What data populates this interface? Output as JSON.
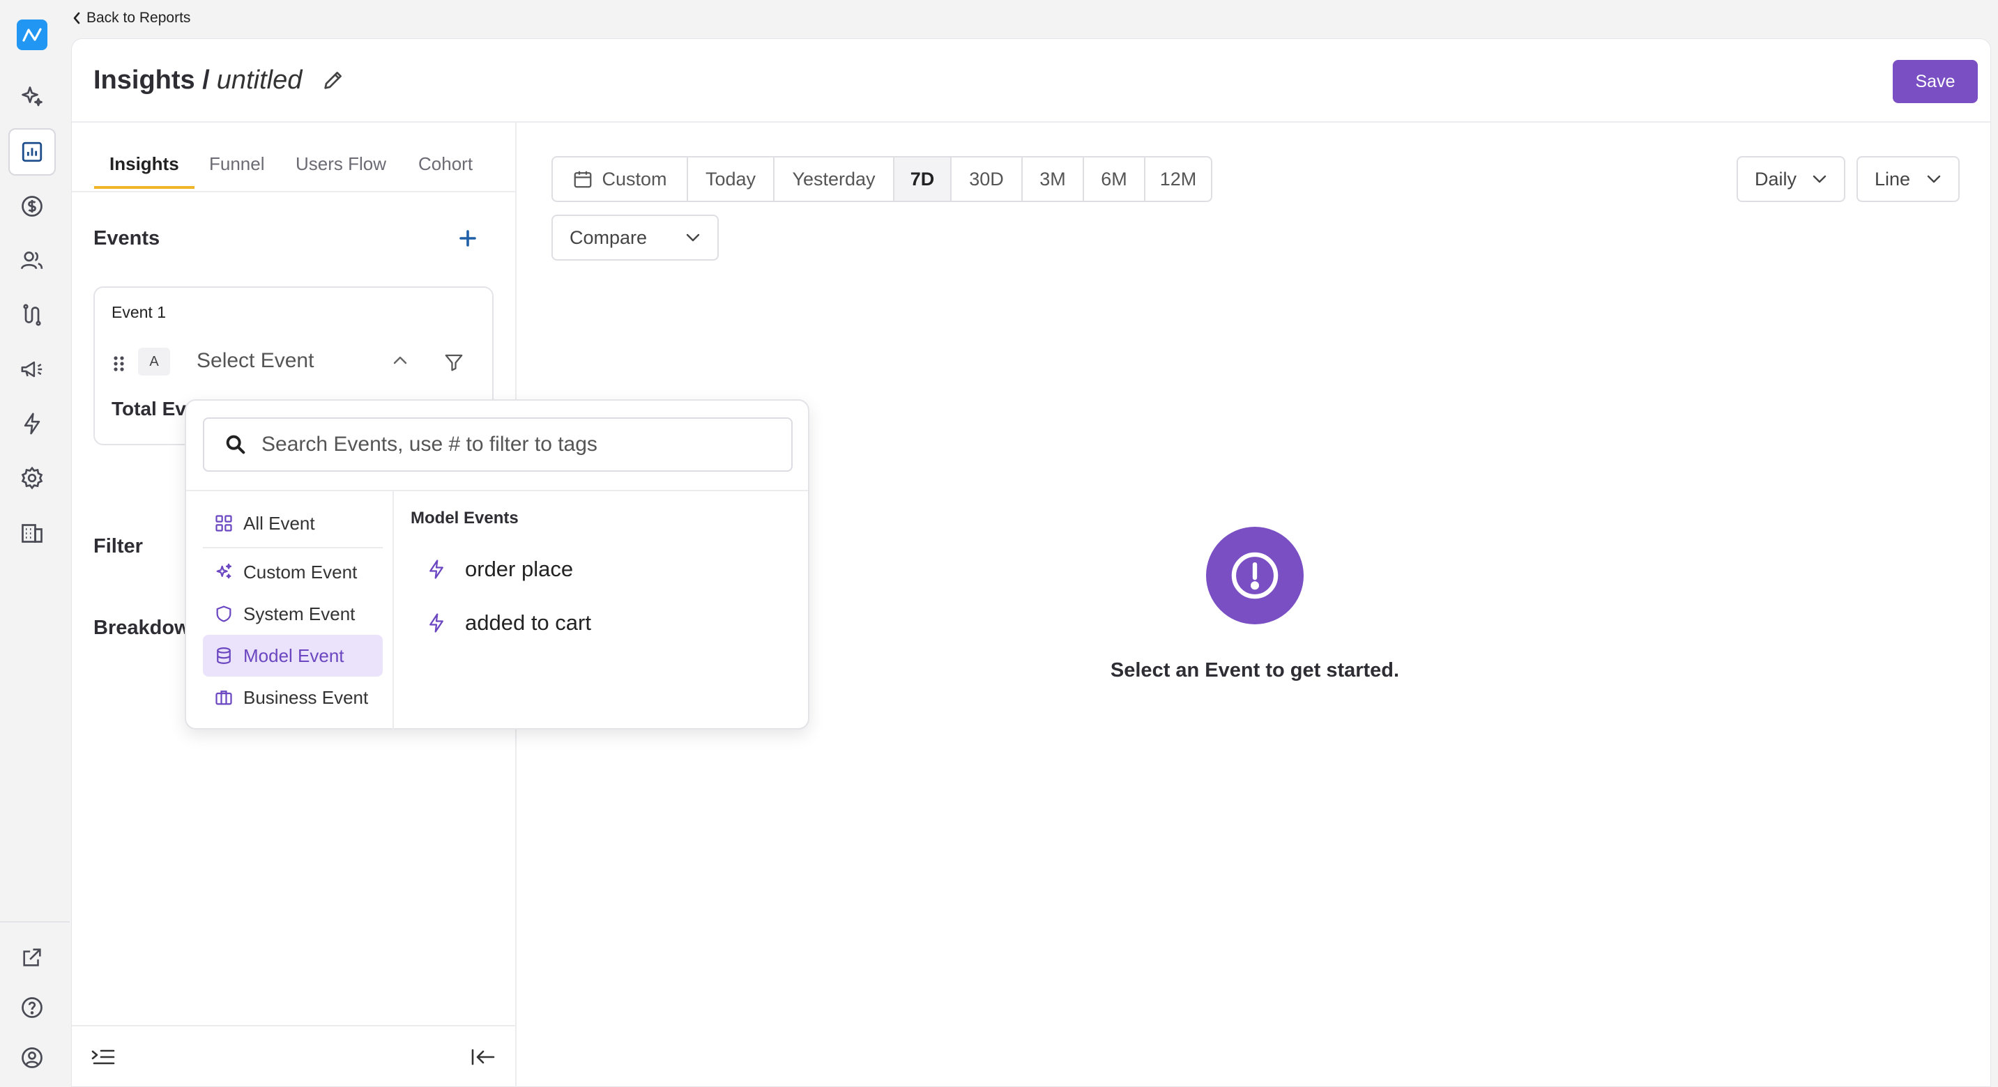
{
  "back_link": {
    "label": "Back to Reports"
  },
  "header": {
    "title_main": "Insights /",
    "title_sub": "untitled",
    "save_label": "Save"
  },
  "sidebar": {
    "icons": [
      "app-logo-icon",
      "sparkles-icon",
      "reports-icon",
      "dollar-icon",
      "users-icon",
      "journey-icon",
      "megaphone-icon",
      "bolt-icon",
      "settings-icon",
      "building-icon",
      "external-link-icon",
      "help-icon",
      "user-account-icon"
    ],
    "active": "reports-icon"
  },
  "tabs": [
    {
      "label": "Insights",
      "active": true
    },
    {
      "label": "Funnel",
      "active": false
    },
    {
      "label": "Users Flow",
      "active": false
    },
    {
      "label": "Cohort",
      "active": false
    }
  ],
  "left_panel": {
    "events_title": "Events",
    "event_card": {
      "name": "Event 1",
      "letter": "A",
      "select_label": "Select Event",
      "metric_label": "Total Ev"
    },
    "filter_title": "Filter",
    "breakdown_title": "Breakdow"
  },
  "toolbar": {
    "ranges": [
      {
        "label": "Custom",
        "active": false
      },
      {
        "label": "Today",
        "active": false
      },
      {
        "label": "Yesterday",
        "active": false
      },
      {
        "label": "7D",
        "active": true
      },
      {
        "label": "30D",
        "active": false
      },
      {
        "label": "3M",
        "active": false
      },
      {
        "label": "6M",
        "active": false
      },
      {
        "label": "12M",
        "active": false
      }
    ],
    "compare_label": "Compare",
    "interval_label": "Daily",
    "chart_type_label": "Line"
  },
  "empty_state": {
    "message": "Select an Event to get started."
  },
  "popover": {
    "search_placeholder": "Search Events, use # to filter to tags",
    "categories": [
      {
        "label": "All Event",
        "active": false
      },
      {
        "label": "Custom Event",
        "active": false
      },
      {
        "label": "System Event",
        "active": false
      },
      {
        "label": "Model Event",
        "active": true
      },
      {
        "label": "Business Event",
        "active": false
      }
    ],
    "group_title": "Model Events",
    "events": [
      "order place",
      "added to cart"
    ]
  },
  "colors": {
    "accent": "#7a4fc4",
    "accent_light": "#ebe3fb",
    "tab_underline": "#f0b429",
    "add_plus": "#1f5fa8",
    "logo": "#2196f3"
  }
}
